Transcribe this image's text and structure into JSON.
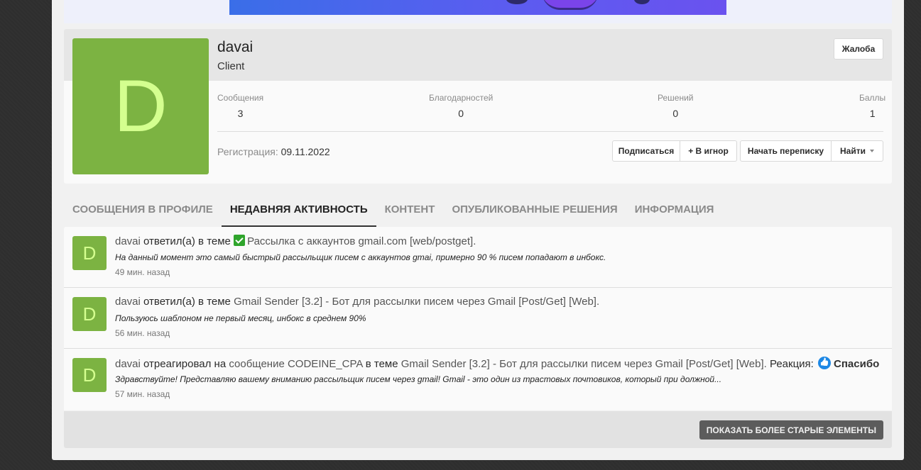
{
  "profile": {
    "avatar_letter": "D",
    "username": "davai",
    "user_title": "Client",
    "report_label": "Жалоба",
    "stats": [
      {
        "label": "Сообщения",
        "value": "3"
      },
      {
        "label": "Благодарностей",
        "value": "0"
      },
      {
        "label": "Решений",
        "value": "0"
      },
      {
        "label": "Баллы",
        "value": "1"
      }
    ],
    "registration_label": "Регистрация:",
    "registration_date": "09.11.2022",
    "actions": {
      "follow": "Подписаться",
      "ignore": "+ В игнор",
      "conversation": "Начать переписку",
      "find": "Найти"
    },
    "avatar_color": "#7cb342"
  },
  "tabs": [
    {
      "label": "СООБЩЕНИЯ В ПРОФИЛЕ"
    },
    {
      "label": "НЕДАВНЯЯ АКТИВНОСТЬ"
    },
    {
      "label": "КОНТЕНТ"
    },
    {
      "label": "ОПУБЛИКОВАННЫЕ РЕШЕНИЯ"
    },
    {
      "label": "ИНФОРМАЦИЯ"
    }
  ],
  "active_tab": "НЕДАВНЯЯ АКТИВНОСТЬ",
  "feed": [
    {
      "avatar_letter": "D",
      "user": "davai",
      "action": "ответил(а) в теме",
      "thread_icon": "check-mark-icon",
      "thread": "Рассылка с аккаунтов gmail.com [web/postget].",
      "snippet": "На данный момент это самый быстрый рассыльщик писем с аккаунтов gmai, примерно 90 % писем попадают в инбокс.",
      "time": "49 мин. назад"
    },
    {
      "avatar_letter": "D",
      "user": "davai",
      "action": "ответил(а) в теме",
      "thread": "Gmail Sender [3.2] - Бот для рассылки писем через Gmail [Post/Get] [Web].",
      "snippet": "Пользуюсь шаблоном не первый месяц, инбокс в среднем 90%",
      "time": "56 мин. назад"
    },
    {
      "avatar_letter": "D",
      "user": "davai",
      "action": "отреагировал на",
      "post_link": "сообщение CODEINE_CPA",
      "in_thread": "в теме",
      "thread": "Gmail Sender [3.2] - Бот для рассылки писем через Gmail [Post/Get] [Web].",
      "reaction_label": "Реакция:",
      "reaction_icon": "thumbs-up-icon",
      "reaction_name": "Спасибо",
      "snippet": "Здравствуйте! Представляю вашему вниманию рассыльщик писем через gmail! Gmail - это один из трастовых почтовиков, который при должной...",
      "time": "57 мин. назад"
    }
  ],
  "show_older_label": "ПОКАЗАТЬ БОЛЕЕ СТАРЫЕ ЭЛЕМЕНТЫ"
}
